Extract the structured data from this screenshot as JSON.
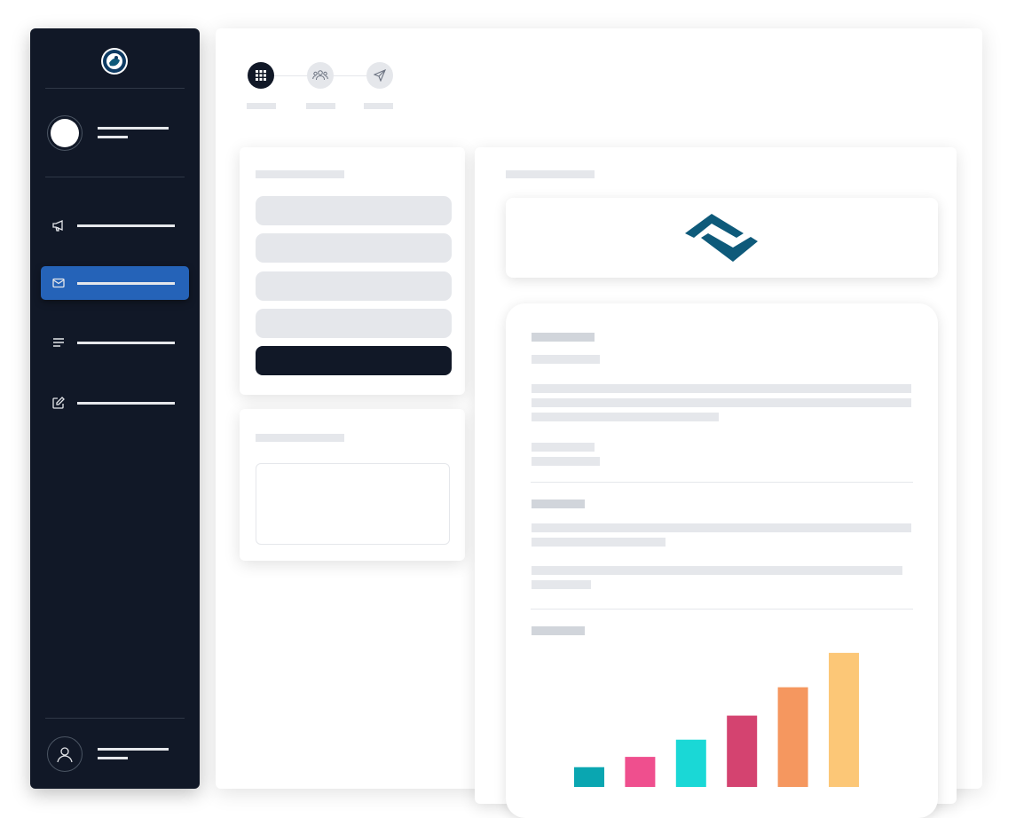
{
  "sidebar": {
    "nav_items": [
      {
        "icon": "megaphone-icon",
        "active": false
      },
      {
        "icon": "mail-icon",
        "active": true
      },
      {
        "icon": "list-icon",
        "active": false
      },
      {
        "icon": "edit-icon",
        "active": false
      }
    ]
  },
  "stepper": {
    "steps": [
      {
        "icon": "grid-icon",
        "active": true
      },
      {
        "icon": "users-icon",
        "active": false
      },
      {
        "icon": "send-icon",
        "active": false
      }
    ]
  },
  "colors": {
    "sidebar_bg": "#111827",
    "accent": "#2563b8",
    "brand": "#0e5a7a"
  },
  "chart_data": {
    "type": "bar",
    "values": [
      23,
      35,
      55,
      83,
      116,
      156
    ],
    "colors": [
      "#0aa6b1",
      "#ef4f8e",
      "#1ad8d6",
      "#d44370",
      "#f5975f",
      "#fcc777"
    ],
    "ylim": [
      0,
      160
    ]
  }
}
